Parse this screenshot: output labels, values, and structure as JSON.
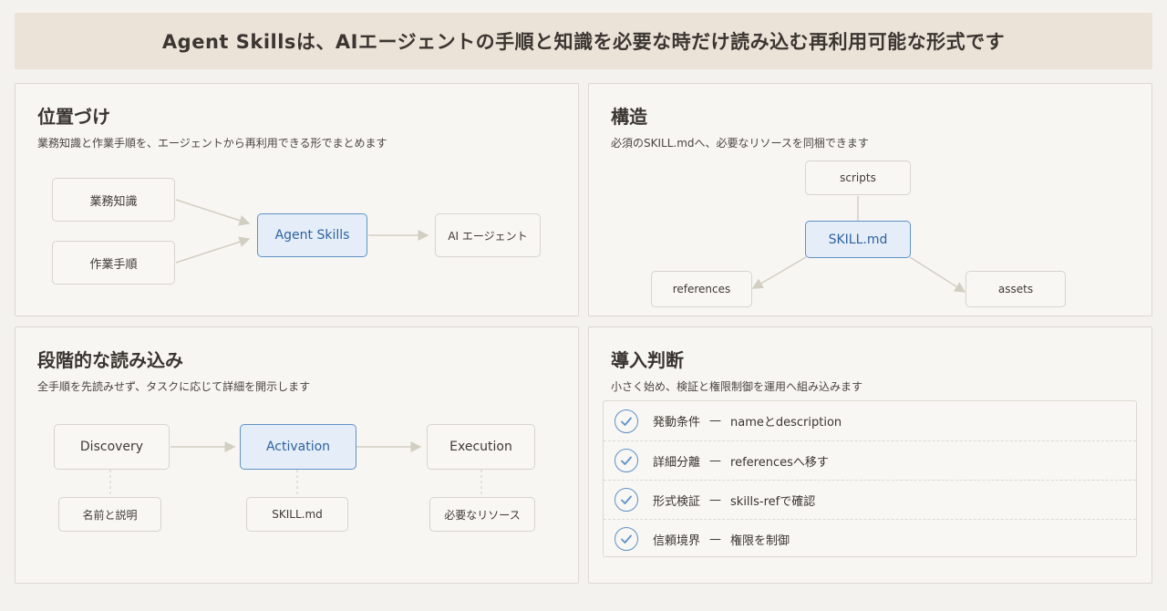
{
  "banner": {
    "title": "Agent Skillsは、AIエージェントの手順と知識を必要な時だけ読み込む再利用可能な形式です"
  },
  "positioning": {
    "title": "位置づけ",
    "subtitle": "業務知識と作業手順を、エージェントから再利用できる形でまとめます",
    "inputs": [
      "業務知識",
      "作業手順"
    ],
    "center": "Agent Skills",
    "output": "AI エージェント"
  },
  "structure": {
    "title": "構造",
    "subtitle": "必須のSKILL.mdへ、必要なリソースを同梱できます",
    "center": "SKILL.md",
    "nodes": {
      "scripts": "scripts",
      "references": "references",
      "assets": "assets"
    }
  },
  "loading": {
    "title": "段階的な読み込み",
    "subtitle": "全手順を先読みせず、タスクに応じて詳細を開示します",
    "stages": [
      "Discovery",
      "Activation",
      "Execution"
    ],
    "details": [
      "名前と説明",
      "SKILL.md",
      "必要なリソース"
    ]
  },
  "adoption": {
    "title": "導入判断",
    "subtitle": "小さく始め、検証と権限制御を運用へ組み込みます",
    "dash": "—",
    "items": [
      {
        "label": "発動条件",
        "desc": "nameとdescription"
      },
      {
        "label": "詳細分離",
        "desc": "referencesへ移す"
      },
      {
        "label": "形式検証",
        "desc": "skills-refで確認"
      },
      {
        "label": "信頼境界",
        "desc": "権限を制御"
      }
    ]
  },
  "colors": {
    "accent": "#5f92c8",
    "banner_bg": "#ebe3d8",
    "arrow": "#d2cfc2"
  }
}
